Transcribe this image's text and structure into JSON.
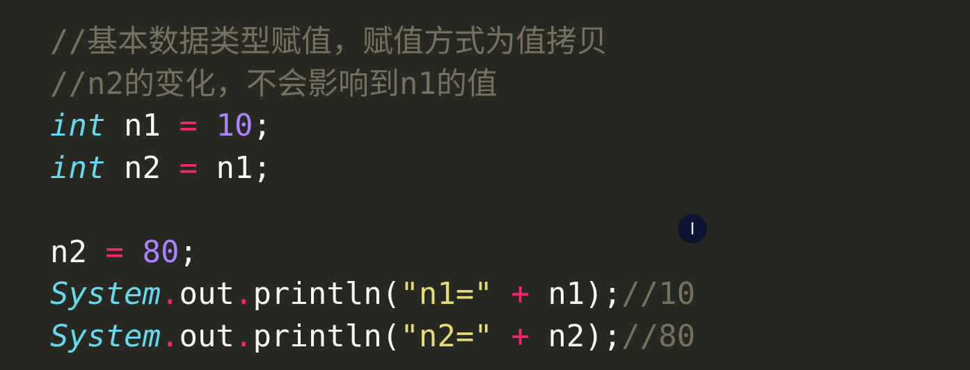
{
  "code": {
    "line1": {
      "comment": "//基本数据类型赋值，赋值方式为值拷贝"
    },
    "line2": {
      "comment": "//n2的变化，不会影响到n1的值"
    },
    "line3": {
      "type": "int",
      "var": "n1",
      "op": "=",
      "value": "10",
      "end": ";"
    },
    "line4": {
      "type": "int",
      "var": "n2",
      "op": "=",
      "value": "n1",
      "end": ";"
    },
    "line6": {
      "var": "n2",
      "op": "=",
      "value": "80",
      "end": ";"
    },
    "line7": {
      "cls": "System",
      "dot1": ".",
      "field": "out",
      "dot2": ".",
      "method": "println(",
      "str": "\"n1=\"",
      "plus": "+",
      "arg": "n1);",
      "comment": "//10"
    },
    "line8": {
      "cls": "System",
      "dot1": ".",
      "field": "out",
      "dot2": ".",
      "method": "println(",
      "str": "\"n2=\"",
      "plus": "+",
      "arg": "n2);",
      "comment": "//80"
    }
  },
  "cursor": {
    "icon": "text-cursor-icon",
    "glyph": "I"
  },
  "colors": {
    "background": "#272822",
    "comment": "#75715e",
    "keyword": "#66d9ef",
    "operator": "#f92672",
    "number": "#ae81ff",
    "string": "#e6db74",
    "text": "#f8f8f2"
  }
}
